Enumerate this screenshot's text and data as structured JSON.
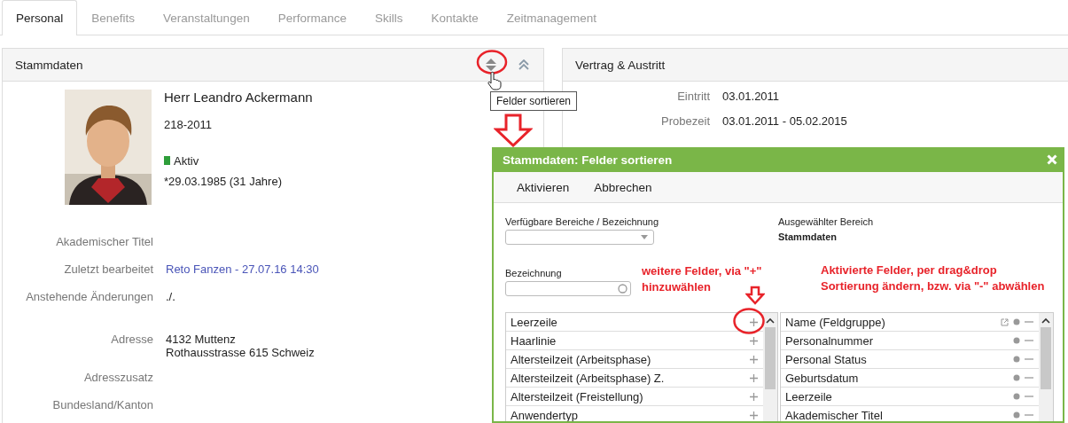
{
  "tabs": [
    {
      "label": "Personal",
      "selected": true
    },
    {
      "label": "Benefits",
      "selected": false
    },
    {
      "label": "Veranstaltungen",
      "selected": false
    },
    {
      "label": "Performance",
      "selected": false
    },
    {
      "label": "Skills",
      "selected": false
    },
    {
      "label": "Kontakte",
      "selected": false
    },
    {
      "label": "Zeitmanagement",
      "selected": false
    }
  ],
  "stammdaten": {
    "title": "Stammdaten",
    "tooltip": "Felder sortieren",
    "person": {
      "name": "Herr Leandro Ackermann",
      "number": "218-2011",
      "status": "Aktiv",
      "birth": "*29.03.1985 (31 Jahre)"
    },
    "groups": [
      {
        "fields": [
          {
            "label": "Akademischer Titel"
          },
          {
            "label": "Zuletzt bearbeitet",
            "values": [
              "Reto Fanzen - 27.07.16 14:30"
            ],
            "link": true
          },
          {
            "label": "Anstehende Änderungen",
            "values": [
              "./."
            ],
            "link": false
          }
        ]
      },
      {
        "fields": [
          {
            "label": "Adresse",
            "values": [
              "4132 Muttenz",
              "Rothausstrasse 615 Schweiz"
            ],
            "link": false
          },
          {
            "label": "Adresszusatz"
          },
          {
            "label": "Bundesland/Kanton"
          }
        ]
      }
    ]
  },
  "vertrag": {
    "title": "Vertrag & Austritt",
    "fields": [
      {
        "label": "Eintritt",
        "value": "03.01.2011"
      },
      {
        "label": "Probezeit",
        "value": "03.01.2011 - 05.02.2015"
      }
    ]
  },
  "dialog": {
    "title": "Stammdaten: Felder sortieren",
    "actions": [
      "Aktivieren",
      "Abbrechen"
    ],
    "area_label": "Verfügbare Bereiche / Bezeichnung",
    "selected_label": "Ausgewählter Bereich",
    "selected_value": "Stammdaten",
    "search_label": "Bezeichnung",
    "notes": [
      "weitere Felder, via \"+\"\nhinzuwählen",
      "Aktivierte Felder, per drag&drop\nSortierung ändern, bzw. via \"-\" abwählen"
    ],
    "available": [
      "Leerzeile",
      "Haarlinie",
      "Altersteilzeit (Arbeitsphase)",
      "Altersteilzeit (Arbeitsphase) Z.",
      "Altersteilzeit (Freistellung)",
      "Anwendertyp"
    ],
    "active": [
      {
        "label": "Name (Feldgruppe)",
        "external": true
      },
      {
        "label": "Personalnummer",
        "external": false
      },
      {
        "label": "Personal Status",
        "external": false
      },
      {
        "label": "Geburtsdatum",
        "external": false
      },
      {
        "label": "Leerzeile",
        "external": false
      },
      {
        "label": "Akademischer Titel",
        "external": false
      }
    ]
  }
}
